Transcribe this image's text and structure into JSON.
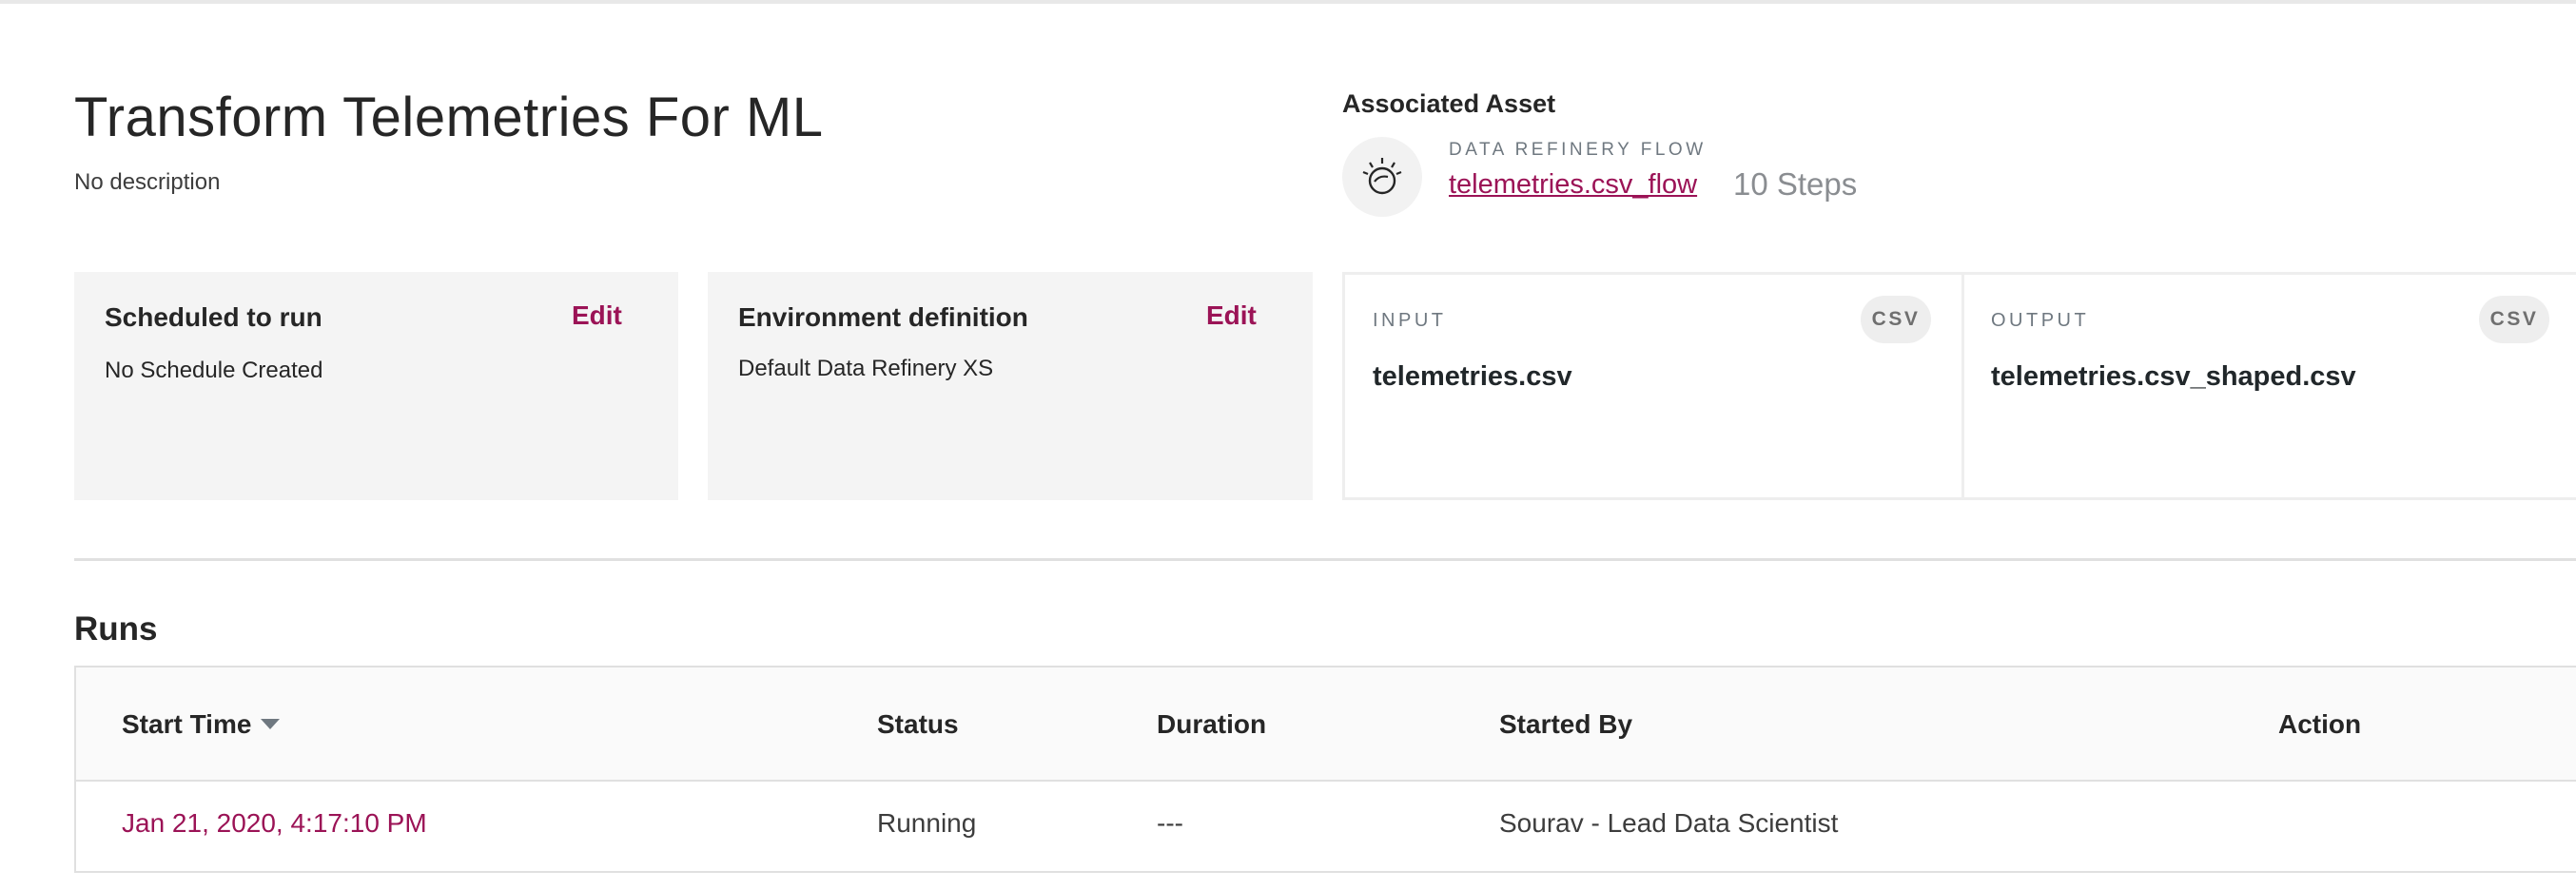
{
  "job": {
    "title": "Transform Telemetries For ML",
    "description": "No description"
  },
  "associated_asset": {
    "heading": "Associated Asset",
    "icon": "data-refinery-icon",
    "type_label": "DATA REFINERY FLOW",
    "flow_name": "telemetries.csv_flow",
    "steps": "10 Steps"
  },
  "schedule_card": {
    "title": "Scheduled to run",
    "edit_label": "Edit",
    "value": "No Schedule Created"
  },
  "environment_card": {
    "title": "Environment definition",
    "edit_label": "Edit",
    "value": "Default Data Refinery XS"
  },
  "io": {
    "input": {
      "label": "INPUT",
      "format": "CSV",
      "file": "telemetries.csv"
    },
    "output": {
      "label": "OUTPUT",
      "format": "CSV",
      "file": "telemetries.csv_shaped.csv"
    }
  },
  "runs": {
    "title": "Runs",
    "columns": {
      "start_time": "Start Time",
      "status": "Status",
      "duration": "Duration",
      "started_by": "Started By",
      "action": "Action"
    },
    "sort": "descending",
    "rows": [
      {
        "start_time": "Jan 21, 2020, 4:17:10 PM",
        "status": "Running",
        "duration": "---",
        "started_by": "Sourav - Lead Data Scientist",
        "action": ""
      }
    ]
  },
  "colors": {
    "accent": "#9b1356",
    "card_bg": "#f4f4f4",
    "muted": "#6f7880"
  }
}
